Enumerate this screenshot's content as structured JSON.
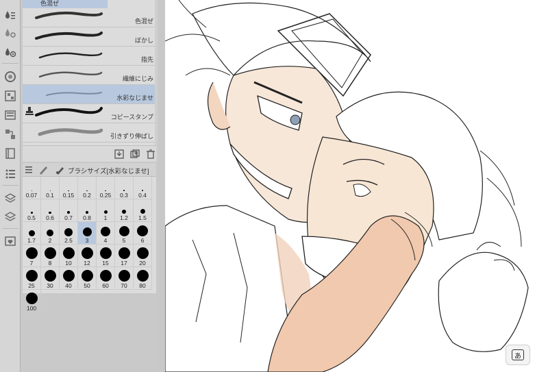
{
  "brush_panel": {
    "top_tab_label": "色混ぜ",
    "items": [
      {
        "label": "色混ぜ"
      },
      {
        "label": "ぼかし"
      },
      {
        "label": "指先"
      },
      {
        "label": "繊維にじみ"
      },
      {
        "label": "水彩なじませ"
      },
      {
        "label": "コピースタンプ"
      },
      {
        "label": "引きずり伸ばし"
      }
    ],
    "selected_index": 4
  },
  "brush_size": {
    "title": "ブラシサイズ[水彩なじませ]",
    "sizes": [
      "0.07",
      "0.1",
      "0.15",
      "0.2",
      "0.25",
      "0.3",
      "0.4",
      "0.5",
      "0.6",
      "0.7",
      "0.8",
      "1",
      "1.2",
      "1.5",
      "1.7",
      "2",
      "2.5",
      "3",
      "4",
      "5",
      "6",
      "7",
      "8",
      "10",
      "12",
      "15",
      "17",
      "20",
      "25",
      "30",
      "40",
      "50",
      "60",
      "70",
      "80",
      "100"
    ],
    "selected": "3"
  },
  "ime": {
    "label": "あ"
  },
  "icons": {
    "toolbar": [
      "subtool-icon",
      "subtool-settings-icon",
      "subtool-detail-icon",
      "color-wheel-icon",
      "color-set-icon",
      "layer-property-icon",
      "navigator-icon",
      "material-icon",
      "timeline-icon",
      "layer-icon",
      "favorite-icon"
    ],
    "actions": [
      "import-icon",
      "duplicate-icon",
      "delete-icon"
    ]
  },
  "colors": {
    "selection": "#b8c8de",
    "panel": "#dcdcdc"
  }
}
